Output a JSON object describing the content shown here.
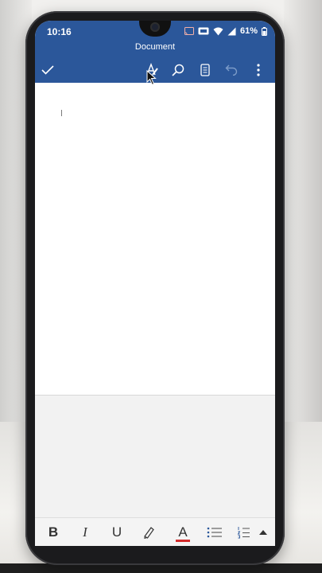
{
  "status_bar": {
    "time": "10:16",
    "battery_percent": "61%",
    "icons": [
      "cast-icon",
      "vowifi-icon",
      "wifi-icon",
      "signal-icon",
      "battery-icon"
    ]
  },
  "header": {
    "title": "Document"
  },
  "toolbar": {
    "items": [
      "done-check-icon",
      "text-format-icon",
      "search-icon",
      "reading-view-icon",
      "undo-icon",
      "more-options-icon"
    ]
  },
  "format_bar": {
    "bold_label": "B",
    "italic_label": "I",
    "underline_label": "U",
    "font_color_label": "A",
    "font_color": "#d32b2b"
  },
  "colors": {
    "app_bar": "#2b579a",
    "document": "#ffffff"
  }
}
